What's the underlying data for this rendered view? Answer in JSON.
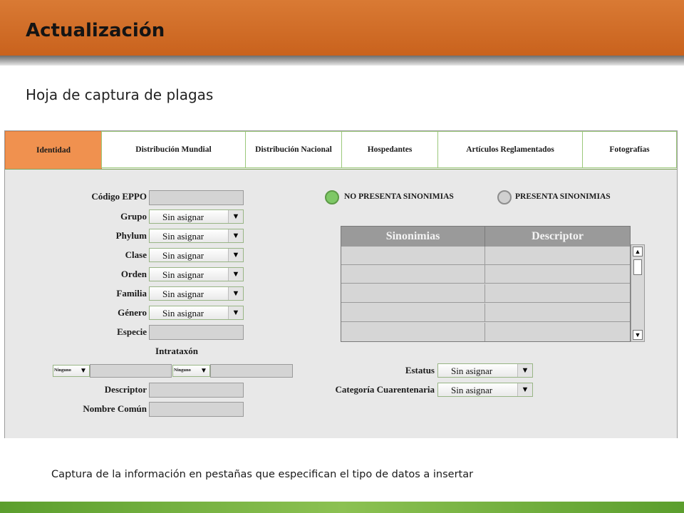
{
  "header": {
    "title": "Actualización"
  },
  "subtitle": "Hoja de captura de plagas",
  "tabs": [
    {
      "label": "Identidad",
      "active": true
    },
    {
      "label": "Distribución Mundial"
    },
    {
      "label": "Distribución Nacional"
    },
    {
      "label": "Hospedantes"
    },
    {
      "label": "Artículos Reglamentados"
    },
    {
      "label": "Fotografías"
    }
  ],
  "form": {
    "codigo_eppo": {
      "label": "Código EPPO",
      "value": ""
    },
    "grupo": {
      "label": "Grupo",
      "value": "Sin asignar"
    },
    "phylum": {
      "label": "Phylum",
      "value": "Sin asignar"
    },
    "clase": {
      "label": "Clase",
      "value": "Sin asignar"
    },
    "orden": {
      "label": "Orden",
      "value": "Sin asignar"
    },
    "familia": {
      "label": "Familia",
      "value": "Sin asignar"
    },
    "genero": {
      "label": "Género",
      "value": "Sin asignar"
    },
    "especie": {
      "label": "Especie",
      "value": ""
    },
    "intrataxon": {
      "label": "Intrataxón",
      "select1": "Ninguno",
      "select2": "Ninguno"
    },
    "descriptor": {
      "label": "Descriptor",
      "value": ""
    },
    "nombre_comun": {
      "label": "Nombre Común",
      "value": ""
    },
    "estatus": {
      "label": "Estatus",
      "value": "Sin asignar"
    },
    "categoria": {
      "label": "Categoría Cuarentenaria",
      "value": "Sin asignar"
    }
  },
  "sinonimias": {
    "option_no": "NO PRESENTA SINONIMIAS",
    "option_yes": "PRESENTA SINONIMIAS",
    "selected": "no",
    "columns": [
      "Sinonimias",
      "Descriptor"
    ],
    "rows": [
      [
        "",
        ""
      ],
      [
        "",
        ""
      ],
      [
        "",
        ""
      ],
      [
        "",
        ""
      ],
      [
        "",
        ""
      ]
    ]
  },
  "caption": "Captura de la información en pestañas que especifican el tipo de datos a insertar",
  "colors": {
    "header_orange": "#d97a34",
    "active_tab": "#f0914f",
    "radio_selected": "#7ec866",
    "footer_green": "#8cc152"
  },
  "icons": [
    "dropdown-arrow-icon",
    "scroll-up-icon",
    "scroll-down-icon",
    "radio-icon"
  ]
}
